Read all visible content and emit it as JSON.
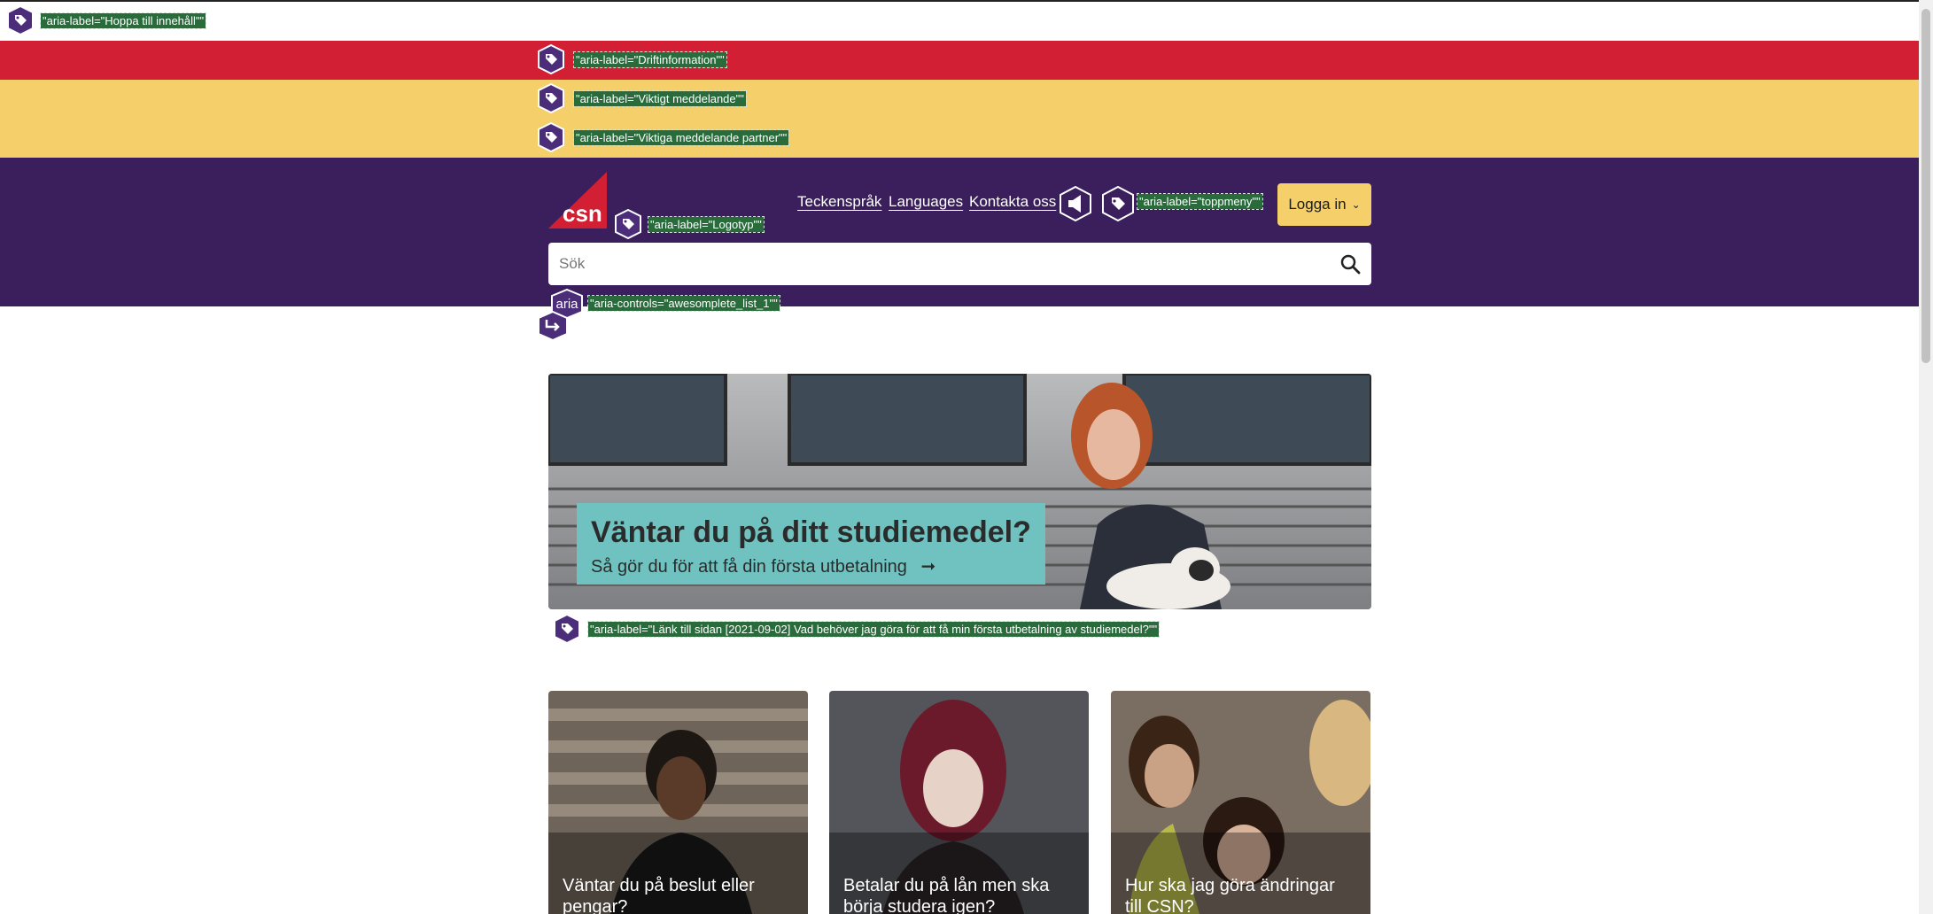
{
  "overlay_labels": {
    "skip_link": "\"aria-label=\"Hoppa till innehåll\"\"",
    "drift": "\"aria-label=\"Driftinformation\"\"",
    "viktigt": "\"aria-label=\"Viktigt meddelande\"\"",
    "partner": "\"aria-label=\"Viktiga meddelande partner\"\"",
    "logotyp": "\"aria-label=\"Logotyp\"\"",
    "toppmeny": "\"aria-label=\"toppmeny\"\"",
    "controls": "\"aria-controls=\"awesomplete_list_1\"\"",
    "hero_link": "\"aria-label=\"Länk till sidan [2021-09-02] Vad behöver jag göra för att få min första utbetalning av studiemedel?\"\""
  },
  "aria_mini_text": "aria",
  "header": {
    "logo_text": "csn",
    "links": [
      "Teckenspråk",
      "Languages",
      "Kontakta oss"
    ],
    "login_label": "Logga in"
  },
  "search": {
    "placeholder": "Sök"
  },
  "hero": {
    "title": "Väntar du på ditt studiemedel?",
    "subtitle": "Så gör du för att få din första utbetalning"
  },
  "cards": [
    {
      "title": "Väntar du på beslut eller pengar?"
    },
    {
      "title": "Betalar du på lån men ska börja studera igen?"
    },
    {
      "title": "Hur ska jag göra ändringar till CSN?"
    }
  ],
  "colors": {
    "red_band": "#d21f34",
    "yellow_band": "#f4cf6a",
    "purple_band": "#3a1f5c",
    "teal_caption": "#6fc2bf",
    "overlay_label_bg": "#2a6b3c"
  }
}
